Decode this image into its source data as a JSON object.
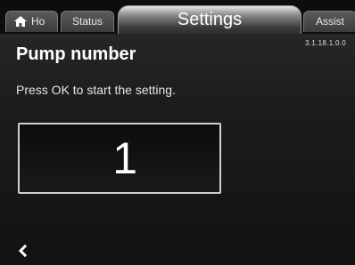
{
  "tabs": {
    "home": {
      "label": "Ho",
      "icon": "home-icon"
    },
    "status": {
      "label": "Status"
    },
    "settings": {
      "label": "Settings"
    },
    "assist": {
      "label": "Assist"
    }
  },
  "version": "3.1.18.1.0.0",
  "page": {
    "title": "Pump number",
    "instruction": "Press OK to start the setting.",
    "value": "1"
  },
  "footer": {
    "back_icon": "chevron-left-icon"
  }
}
